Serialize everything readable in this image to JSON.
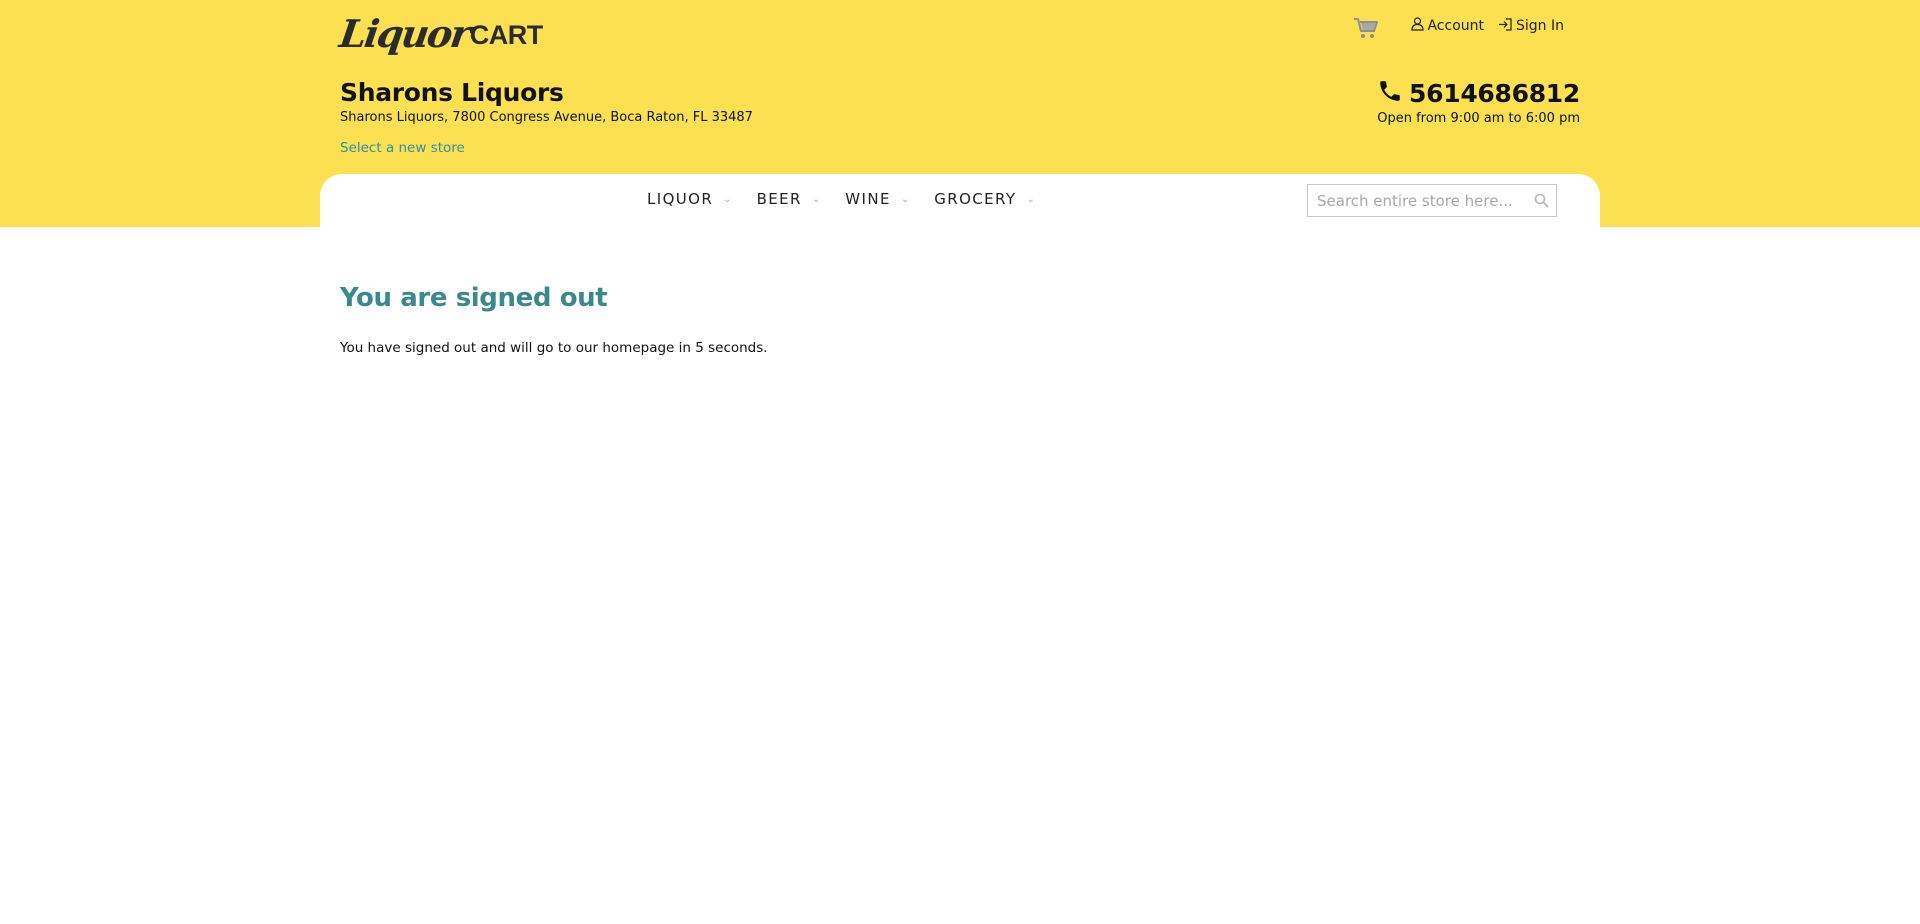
{
  "brand": {
    "logo_script": "Liquor",
    "logo_caps": "CART",
    "colors": {
      "header_bg": "#fbe052",
      "title_teal": "#3a8a8c",
      "link_blue": "#2f8fb0"
    }
  },
  "top_links": {
    "cart_icon": "shopping-cart-icon",
    "account_label": "Account",
    "sign_in_label": "Sign In"
  },
  "store": {
    "name": "Sharons Liquors",
    "address": "Sharons Liquors, 7800 Congress Avenue, Boca Raton, FL 33487",
    "select_new_label": "Select a new store",
    "phone": "5614686812",
    "hours": "Open from 9:00 am to 6:00 pm"
  },
  "nav": {
    "items": [
      {
        "label": "LIQUOR"
      },
      {
        "label": "BEER"
      },
      {
        "label": "WINE"
      },
      {
        "label": "GROCERY"
      }
    ],
    "caret": "⌄"
  },
  "search": {
    "placeholder": "Search entire store here...",
    "value": ""
  },
  "main": {
    "title": "You are signed out",
    "message": "You have signed out and will go to our homepage in 5 seconds."
  }
}
